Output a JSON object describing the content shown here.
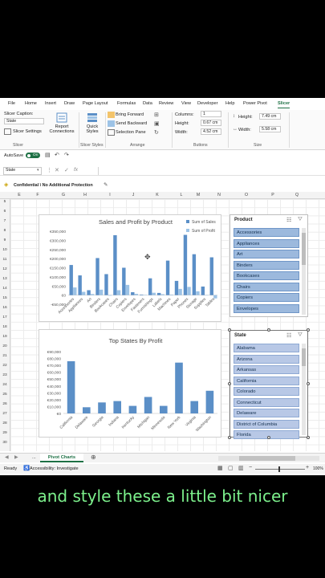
{
  "ribbon": {
    "tabs": [
      "File",
      "Home",
      "Insert",
      "Draw",
      "Page Layout",
      "Formulas",
      "Data",
      "Review",
      "View",
      "Developer",
      "Help",
      "Power Pivot",
      "Slicer"
    ],
    "slicer_caption_label": "Slicer Caption:",
    "slicer_caption_value": "State",
    "slicer_settings": "Slicer Settings",
    "report_connections": "Report Connections",
    "quick_styles": "Quick Styles",
    "bring_forward": "Bring Forward",
    "send_backward": "Send Backward",
    "selection_pane": "Selection Pane",
    "columns_label": "Columns:",
    "columns_value": "1",
    "height_label": "Height:",
    "height_value": "0.67 cm",
    "width_label": "Width:",
    "width_value": "4.52 cm",
    "shape_height_label": "Height:",
    "shape_height_value": "7.49 cm",
    "shape_width_label": "Width:",
    "shape_width_value": "5.58 cm",
    "groups": [
      "Slicer",
      "Slicer Styles",
      "Arrange",
      "Buttons",
      "Size"
    ]
  },
  "qat": {
    "autosave": "AutoSave",
    "toggle": "On"
  },
  "namebox": "State",
  "infobar": "Confidential \\ No Additional Protection",
  "columns": [
    "E",
    "F",
    "G",
    "H",
    "I",
    "J",
    "K",
    "L",
    "M",
    "N",
    "O",
    "P",
    "Q"
  ],
  "rows": [
    "5",
    "6",
    "7",
    "8",
    "9",
    "10",
    "11",
    "12",
    "13",
    "14",
    "15",
    "16",
    "17",
    "18",
    "19",
    "20",
    "21",
    "22",
    "23",
    "24",
    "25",
    "26",
    "27",
    "28",
    "29",
    "30"
  ],
  "chart1": {
    "title": "Sales and Profit by Product",
    "legend": [
      "Sum of Sales",
      "Sum of Profit"
    ],
    "yticks": [
      "€350,000",
      "€300,000",
      "€250,000",
      "€200,000",
      "€150,000",
      "€100,000",
      "€50,000",
      "€0",
      "-€50,000"
    ]
  },
  "chart2": {
    "title": "Top  States By Profit",
    "yticks": [
      "€90,000",
      "€80,000",
      "€70,000",
      "€60,000",
      "€50,000",
      "€40,000",
      "€30,000",
      "€20,000",
      "€10,000",
      "€0"
    ]
  },
  "chart_data": [
    {
      "type": "bar",
      "title": "Sales and Profit by Product",
      "categories": [
        "Accessories",
        "Appliances",
        "Art",
        "Binders",
        "Bookcases",
        "Chairs",
        "Copiers",
        "Envelopes",
        "Fasteners",
        "Furnishings",
        "Labels",
        "Machines",
        "Paper",
        "Phones",
        "Storage",
        "Supplies",
        "Tables"
      ],
      "series": [
        {
          "name": "Sum of Sales",
          "values": [
            165000,
            108000,
            27000,
            203000,
            115000,
            328000,
            150000,
            16000,
            3000,
            92000,
            12000,
            189000,
            78000,
            330000,
            224000,
            47000,
            207000
          ]
        },
        {
          "name": "Sum of Profit",
          "values": [
            42000,
            18000,
            6000,
            30000,
            -3000,
            27000,
            56000,
            7000,
            1000,
            13000,
            5000,
            3000,
            34000,
            45000,
            21000,
            -1000,
            -18000
          ]
        }
      ],
      "ylim": [
        -50000,
        350000
      ]
    },
    {
      "type": "bar",
      "title": "Top  States By Profit",
      "categories": [
        "California",
        "Delaware",
        "Georgia",
        "Indiana",
        "Kentucky",
        "Michigan",
        "Minnesota",
        "New York",
        "Virginia",
        "Washington"
      ],
      "values": [
        76000,
        9000,
        16000,
        18000,
        11000,
        24000,
        11000,
        74000,
        18000,
        33000
      ],
      "ylim": [
        0,
        90000
      ]
    }
  ],
  "product_slicer": {
    "title": "Product",
    "items": [
      "Accessories",
      "Appliances",
      "Art",
      "Binders",
      "Bookcases",
      "Chairs",
      "Copiers",
      "Envelopes"
    ]
  },
  "state_slicer": {
    "title": "State",
    "items": [
      "Alabama",
      "Arizona",
      "Arkansas",
      "California",
      "Colorado",
      "Connecticut",
      "Delaware",
      "District of Columbia",
      "Florida"
    ]
  },
  "sheet": {
    "nav": "...",
    "tab": "Pivot Charts"
  },
  "status": {
    "ready": "Ready",
    "accessibility": "Accessibility: Investigate",
    "zoom": "100%"
  },
  "caption": "and style these a little bit nicer",
  "colors": {
    "bar": "#5b8fc7",
    "bar_light": "#9dc3e6",
    "accent": "#1e7145"
  }
}
